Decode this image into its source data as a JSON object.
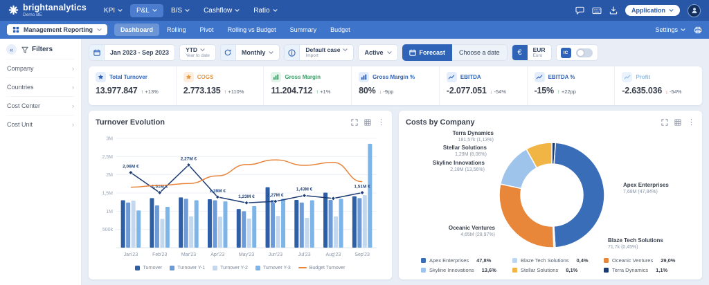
{
  "topbar": {
    "brand": "brightanalytics",
    "environment": "Demo BE",
    "nav": [
      {
        "label": "KPI",
        "caret": true,
        "active": false
      },
      {
        "label": "P&L",
        "caret": true,
        "active": true
      },
      {
        "label": "B/S",
        "caret": true,
        "active": false
      },
      {
        "label": "Cashflow",
        "caret": true,
        "active": false
      },
      {
        "label": "Ratio",
        "caret": true,
        "active": false
      }
    ],
    "application_label": "Application"
  },
  "subbar": {
    "workspace": "Management Reporting",
    "tabs": [
      {
        "label": "Dashboard",
        "active": true
      },
      {
        "label": "Rolling",
        "active": false
      },
      {
        "label": "Pivot",
        "active": false
      },
      {
        "label": "Rolling vs Budget",
        "active": false
      },
      {
        "label": "Summary",
        "active": false
      },
      {
        "label": "Budget",
        "active": false
      }
    ],
    "settings_label": "Settings"
  },
  "sidebar": {
    "title": "Filters",
    "items": [
      "Company",
      "Countries",
      "Cost Center",
      "Cost Unit"
    ]
  },
  "toolbar": {
    "date_range": "Jan 2023 - Sep 2023",
    "ytd": {
      "label": "YTD",
      "sub": "Year to date"
    },
    "period": "Monthly",
    "case": {
      "label": "Default case",
      "sub": "Import"
    },
    "status": "Active",
    "forecast_label": "Forecast",
    "choose_date_label": "Choose a date",
    "currency": {
      "symbol": "€",
      "code": "EUR",
      "name": "Euro"
    },
    "ic_label": "IC"
  },
  "kpis": [
    {
      "label": "Total Turnover",
      "icon": "star",
      "accent": "#2e63b8",
      "icon_bg": "#e3edfb",
      "value": "13.977.847",
      "arrow": "up",
      "arrow_color": "#2fa060",
      "delta": "+13%"
    },
    {
      "label": "COGS",
      "icon": "star",
      "accent": "#e8963c",
      "icon_bg": "#fdeede",
      "value": "2.773.135",
      "arrow": "up",
      "arrow_color": "#e05252",
      "delta": "+110%"
    },
    {
      "label": "Gross Margin",
      "icon": "bars",
      "accent": "#3fa06b",
      "icon_bg": "#e2f4ea",
      "value": "11.204.712",
      "arrow": "up",
      "arrow_color": "#2fa060",
      "delta": "+1%"
    },
    {
      "label": "Gross Margin %",
      "icon": "bars",
      "accent": "#2e63b8",
      "icon_bg": "#e3edfb",
      "value": "80%",
      "arrow": "down",
      "arrow_color": "#e05252",
      "delta": "-9pp"
    },
    {
      "label": "EBITDA",
      "icon": "line",
      "accent": "#2e63b8",
      "icon_bg": "#e3edfb",
      "value": "-2.077.051",
      "arrow": "down",
      "arrow_color": "#e05252",
      "delta": "-54%"
    },
    {
      "label": "EBITDA %",
      "icon": "line",
      "accent": "#2e63b8",
      "icon_bg": "#e3edfb",
      "value": "-15%",
      "arrow": "up",
      "arrow_color": "#2fa060",
      "delta": "+22pp"
    },
    {
      "label": "Profit",
      "icon": "line",
      "accent": "#8fbce8",
      "icon_bg": "#eaf3fc",
      "value": "-2.635.036",
      "arrow": "down",
      "arrow_color": "#e05252",
      "delta": "-54%"
    }
  ],
  "chart_data": [
    {
      "type": "bar",
      "title": "Turnover Evolution",
      "unit": "M€",
      "categories": [
        "Jan'23",
        "Feb'23",
        "Mar'23",
        "Apr'23",
        "May'23",
        "Jun'23",
        "Jul'23",
        "Aug'23",
        "Sep'23"
      ],
      "ylim": [
        0,
        3
      ],
      "yticks": [
        {
          "v": 0.5,
          "label": "500k"
        },
        {
          "v": 1,
          "label": "1M"
        },
        {
          "v": 1.5,
          "label": "1,5M"
        },
        {
          "v": 2,
          "label": "2M"
        },
        {
          "v": 2.5,
          "label": "2,5M"
        },
        {
          "v": 3,
          "label": "3M"
        }
      ],
      "series": [
        {
          "name": "Turnover",
          "type": "bar",
          "color": "#2d5ea6",
          "values": [
            1.3,
            1.36,
            1.38,
            1.33,
            1.06,
            1.66,
            1.31,
            1.51,
            1.41
          ]
        },
        {
          "name": "Turnover Y-1",
          "type": "bar",
          "color": "#6d9bd8",
          "values": [
            1.24,
            1.16,
            1.34,
            1.3,
            1.0,
            1.31,
            1.24,
            1.31,
            1.36
          ]
        },
        {
          "name": "Turnover Y-2",
          "type": "bar",
          "color": "#c3d7ef",
          "values": [
            1.29,
            0.79,
            0.86,
            0.85,
            0.8,
            0.87,
            0.82,
            0.86,
            1.44
          ]
        },
        {
          "name": "Turnover Y-3",
          "type": "bar",
          "color": "#7db5e8",
          "values": [
            1.02,
            1.12,
            1.3,
            1.27,
            1.14,
            1.34,
            1.3,
            1.34,
            2.85
          ]
        },
        {
          "name": "Turnover",
          "type": "line",
          "smooth": false,
          "markers": true,
          "color": "#1d3c74",
          "values": [
            2.06,
            1.51,
            2.27,
            1.39,
            1.23,
            1.27,
            1.43,
            1.35,
            1.51
          ],
          "labels": [
            "2,06M €",
            "1,51M €",
            "2,27M €",
            "1,39M €",
            "1,23M €",
            "1,27M €",
            "1,43M €",
            null,
            "1,51M €"
          ]
        },
        {
          "name": "Budget Turnover",
          "type": "line",
          "smooth": true,
          "markers": false,
          "color": "#e8833a",
          "values": [
            1.66,
            1.71,
            1.76,
            1.97,
            2.28,
            2.41,
            2.26,
            2.34,
            1.81
          ]
        }
      ],
      "legend": [
        {
          "label": "Turnover",
          "color": "#2d5ea6",
          "marker": "square"
        },
        {
          "label": "Turnover Y-1",
          "color": "#6d9bd8",
          "marker": "square"
        },
        {
          "label": "Turnover Y-2",
          "color": "#c3d7ef",
          "marker": "square"
        },
        {
          "label": "Turnover Y-3",
          "color": "#7db5e8",
          "marker": "square"
        },
        {
          "label": "Budget Turnover",
          "color": "#e8833a",
          "marker": "line"
        }
      ]
    },
    {
      "type": "pie",
      "title": "Costs by Company",
      "slices": [
        {
          "name": "Terra Dynamics",
          "display": "181,57k (1,13%)",
          "pct": 1.13,
          "color": "#1d3a6e"
        },
        {
          "name": "Apex Enterprises",
          "display": "7,68M (47,84%)",
          "pct": 47.84,
          "color": "#3a6db8"
        },
        {
          "name": "Blaze Tech Solutions",
          "display": "71,7k (0,45%)",
          "pct": 0.45,
          "color": "#bcd6f2"
        },
        {
          "name": "Oceanic Ventures",
          "display": "4,65M (28,97%)",
          "pct": 28.97,
          "color": "#e8863a"
        },
        {
          "name": "Skyline Innovations",
          "display": "2,18M (13,56%)",
          "pct": 13.56,
          "color": "#9fc4ec"
        },
        {
          "name": "Stellar Solutions",
          "display": "1,29M (8,06%)",
          "pct": 8.06,
          "color": "#f0b545"
        }
      ],
      "legend": [
        {
          "name": "Apex Enterprises",
          "pct": "47,8%"
        },
        {
          "name": "Blaze Tech Solutions",
          "pct": "0,4%"
        },
        {
          "name": "Oceanic Ventures",
          "pct": "29,0%"
        },
        {
          "name": "Skyline Innovations",
          "pct": "13,6%"
        },
        {
          "name": "Stellar Solutions",
          "pct": "8,1%"
        },
        {
          "name": "Terra Dynamics",
          "pct": "1,1%"
        }
      ]
    }
  ]
}
